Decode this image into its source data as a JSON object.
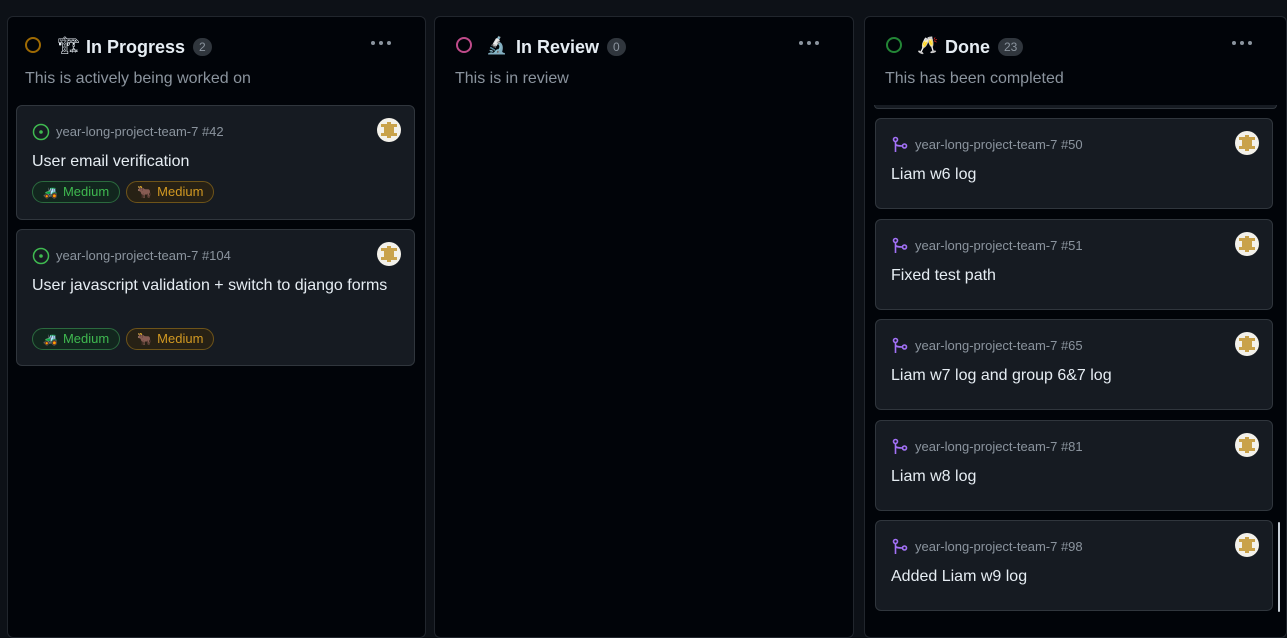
{
  "columns": [
    {
      "title": "In Progress",
      "emoji": "🏗",
      "count": "2",
      "description": "This is actively being worked on",
      "status_color": "#9e6a03",
      "cards": [
        {
          "repo": "year-long-project-team-7 #42",
          "title": "User email verification",
          "type": "issue",
          "labels": [
            {
              "emoji": "🚜",
              "text": "Medium",
              "color": "green"
            },
            {
              "emoji": "🐂",
              "text": "Medium",
              "color": "yellow"
            }
          ]
        },
        {
          "repo": "year-long-project-team-7 #104",
          "title": "User javascript validation + switch to django forms",
          "type": "issue",
          "labels": [
            {
              "emoji": "🚜",
              "text": "Medium",
              "color": "green"
            },
            {
              "emoji": "🐂",
              "text": "Medium",
              "color": "yellow"
            }
          ]
        }
      ]
    },
    {
      "title": "In Review",
      "emoji": "🔬",
      "count": "0",
      "description": "This is in review",
      "status_color": "#bf4b8a",
      "cards": []
    },
    {
      "title": "Done",
      "emoji": "🥂",
      "count": "23",
      "description": "This has been completed",
      "status_color": "#238636",
      "cards": [
        {
          "repo": "year-long-project-team-7 #50",
          "title": "Liam w6 log",
          "type": "pr"
        },
        {
          "repo": "year-long-project-team-7 #51",
          "title": "Fixed test path",
          "type": "pr"
        },
        {
          "repo": "year-long-project-team-7 #65",
          "title": "Liam w7 log and group 6&7 log",
          "type": "pr"
        },
        {
          "repo": "year-long-project-team-7 #81",
          "title": "Liam w8 log",
          "type": "pr"
        },
        {
          "repo": "year-long-project-team-7 #98",
          "title": "Added Liam w9 log",
          "type": "pr"
        }
      ]
    }
  ],
  "colors": {
    "issue_open": "#3fb950",
    "pr_merged": "#a371f7"
  }
}
